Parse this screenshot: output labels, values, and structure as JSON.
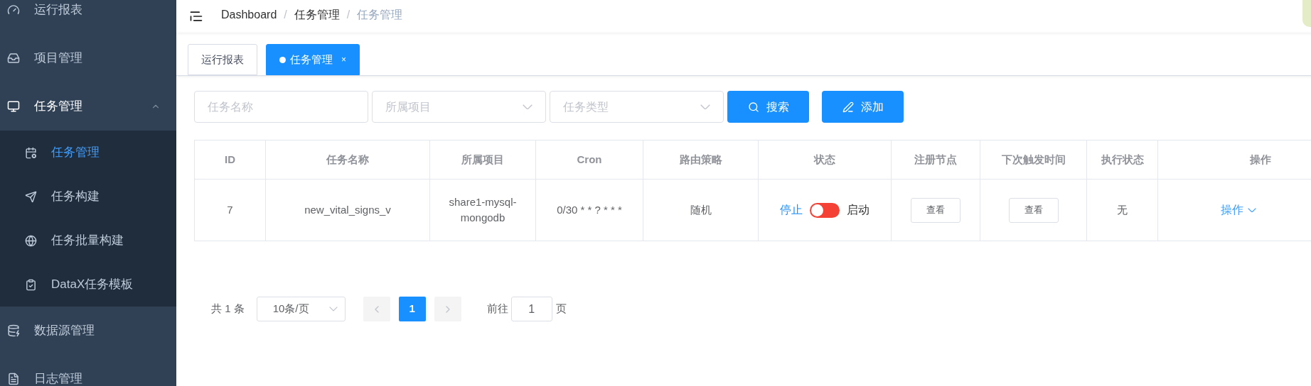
{
  "sidebar": {
    "items": [
      {
        "label": "运行报表",
        "selected": false
      },
      {
        "label": "项目管理",
        "selected": false
      },
      {
        "label": "任务管理",
        "selected": false,
        "expanded": true,
        "children": [
          {
            "label": "任务管理",
            "selected": true
          },
          {
            "label": "任务构建",
            "selected": false
          },
          {
            "label": "任务批量构建",
            "selected": false
          },
          {
            "label": "DataX任务模板",
            "selected": false
          }
        ]
      },
      {
        "label": "数据源管理",
        "selected": false
      },
      {
        "label": "日志管理",
        "selected": false
      }
    ]
  },
  "breadcrumb": [
    "Dashboard",
    "任务管理",
    "任务管理"
  ],
  "breadcrumb_separator": "/",
  "tabs": [
    {
      "label": "运行报表",
      "selected": false
    },
    {
      "label": "任务管理",
      "selected": true,
      "close": "×"
    }
  ],
  "filters": [
    {
      "kind": "input",
      "placeholder": "任务名称"
    },
    {
      "kind": "select",
      "placeholder": "所属项目"
    },
    {
      "kind": "select",
      "placeholder": "任务类型"
    }
  ],
  "buttons": [
    {
      "kind": "search",
      "label": "搜索"
    },
    {
      "kind": "add",
      "label": "添加"
    }
  ],
  "table": {
    "columns": [
      "ID",
      "任务名称",
      "所属项目",
      "Cron",
      "路由策略",
      "状态",
      "注册节点",
      "下次触发时间",
      "执行状态",
      "操作"
    ],
    "rows": [
      {
        "id": "7",
        "name": "new_vital_signs_v",
        "project": "share1-mysql-mongodb",
        "cron": "0/30 * * ? * * *",
        "route": "随机",
        "status": {
          "off_label": "停止",
          "on_label": "启动",
          "on": false
        },
        "node": "查看",
        "next": "查看",
        "exec": "无",
        "action": "操作"
      }
    ]
  },
  "pagination": {
    "total": "共 1 条",
    "page_size": "10条/页",
    "pages": [
      {
        "label": "1",
        "selected": true
      }
    ],
    "goto_label": "前往",
    "goto_value": "1",
    "page_suffix": "页"
  }
}
